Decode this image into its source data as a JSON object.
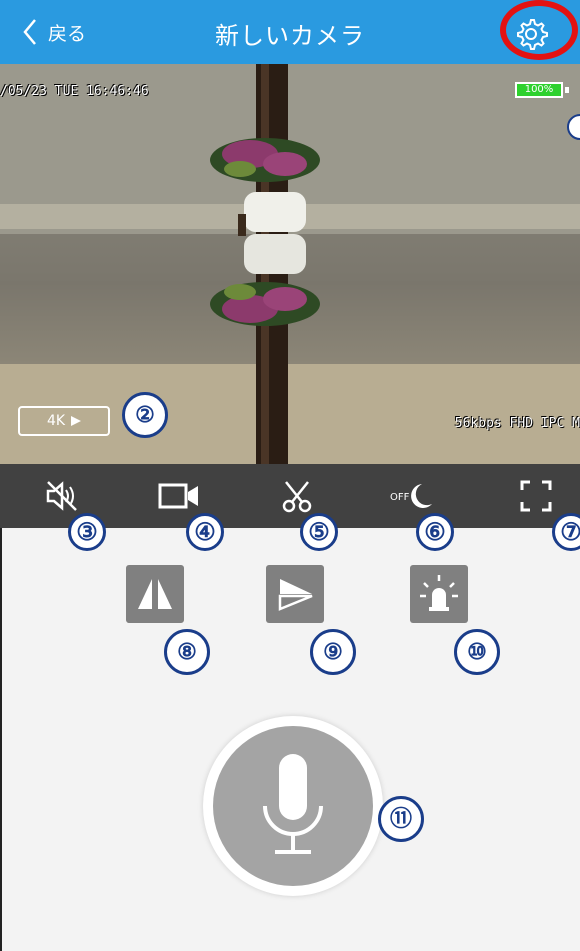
{
  "header": {
    "back_label": "戻る",
    "title": "新しいカメラ",
    "bg_color": "#2a9ae0"
  },
  "video": {
    "timestamp": "/05/23  TUE 16:46:46",
    "battery": "100%",
    "stream_info": "56kbps FHD IPC M",
    "quality_label": "4K"
  },
  "icons": {
    "back": "chevron-left-icon",
    "settings": "gear-icon",
    "mute": "speaker-muted-icon",
    "record": "video-camera-icon",
    "snapshot": "scissors-icon",
    "night": "moon-off-icon",
    "fullscreen": "fullscreen-icon",
    "mirror": "mirror-icon",
    "flip": "flip-icon",
    "alarm": "alarm-light-icon",
    "talk": "microphone-icon"
  },
  "callouts": {
    "n2": "②",
    "n3": "③",
    "n4": "④",
    "n5": "⑤",
    "n6": "⑥",
    "n7": "⑦",
    "n8": "⑧",
    "n9": "⑨",
    "n10": "⑩",
    "n11": "⑪"
  },
  "night_toggle_state": "OFF"
}
